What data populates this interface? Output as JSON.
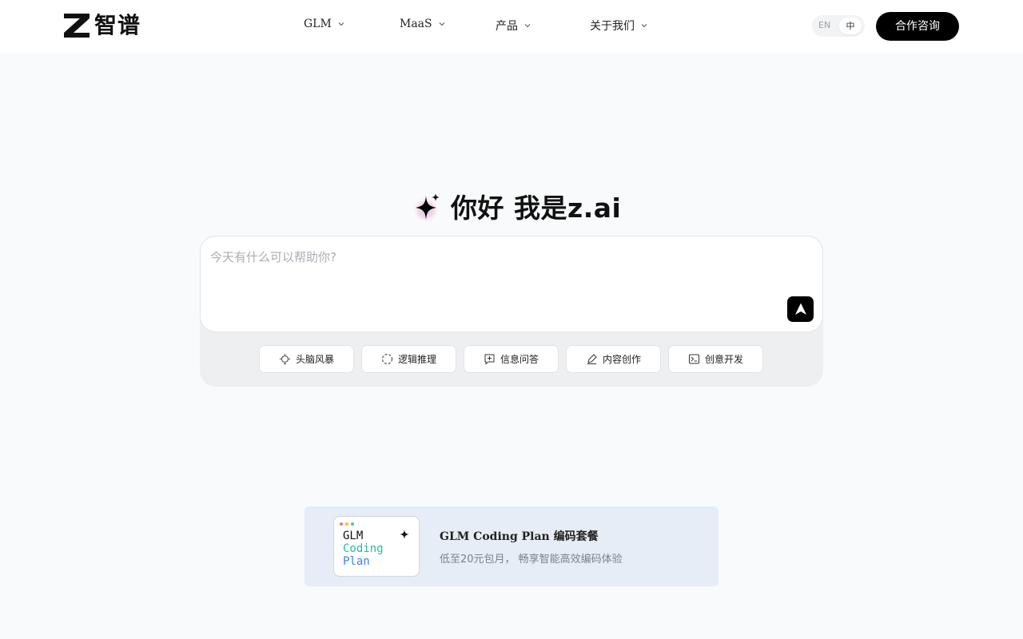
{
  "brand": {
    "name": "智谱",
    "logo_icon": "z-logo-icon"
  },
  "nav": {
    "items": [
      {
        "label": "GLM"
      },
      {
        "label": "MaaS"
      },
      {
        "label": "产品"
      },
      {
        "label": "关于我们"
      }
    ]
  },
  "language": {
    "en": "EN",
    "zh": "中",
    "selected": "中"
  },
  "header": {
    "contact_label": "合作咨询"
  },
  "hero": {
    "title": "你好 我是z.ai",
    "icon": "sparkle-icon"
  },
  "chat": {
    "placeholder": "今天有什么可以帮助你?",
    "send_icon": "send-arrow-icon"
  },
  "chips": [
    {
      "label": "头脑风暴",
      "icon": "lightbulb-icon"
    },
    {
      "label": "逻辑推理",
      "icon": "dashed-circle-icon"
    },
    {
      "label": "信息问答",
      "icon": "chat-plus-icon"
    },
    {
      "label": "内容创作",
      "icon": "pen-icon"
    },
    {
      "label": "创意开发",
      "icon": "terminal-icon"
    }
  ],
  "promo": {
    "card_lines": [
      "GLM",
      "Coding",
      "Plan"
    ],
    "title": "GLM Coding Plan 编码套餐",
    "subtitle": "低至20元包月， 畅享智能高效编码体验"
  },
  "colors": {
    "accent": "#000000",
    "background": "#f8fafc",
    "promo_background": "#e6edf6",
    "coding_green": "#22c29a",
    "plan_blue": "#3b82f6"
  }
}
